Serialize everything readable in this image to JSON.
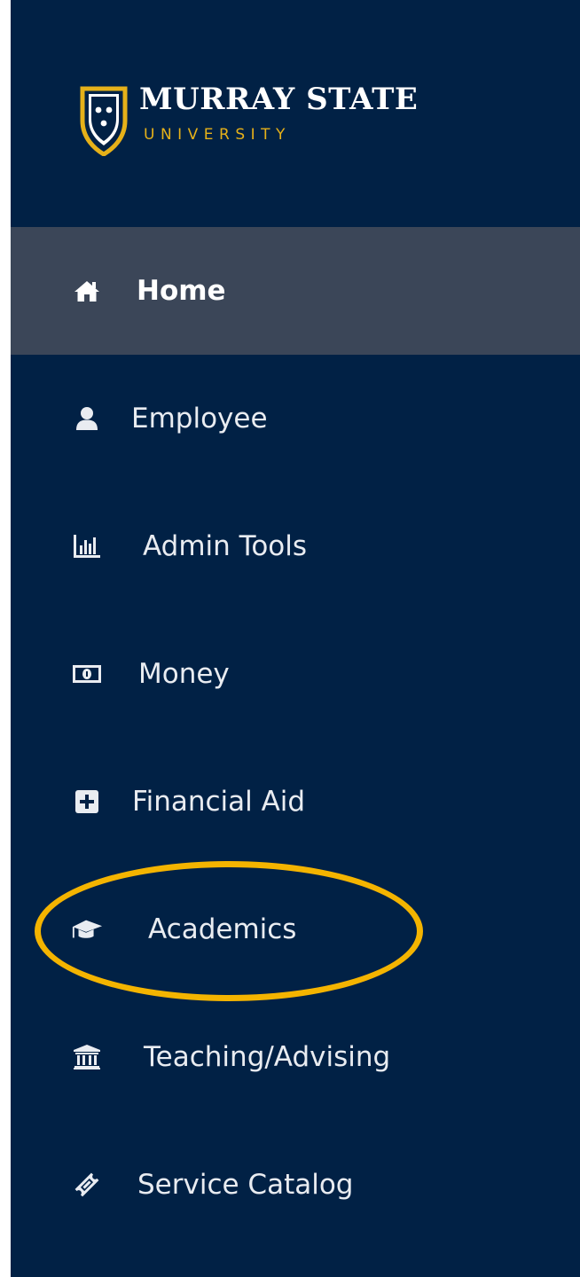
{
  "logo": {
    "name_top": "MURRAY STATE",
    "name_bottom": "UNIVERSITY",
    "shield_icon": "university-shield-icon",
    "accent_color": "#e6b119"
  },
  "theme": {
    "sidebar_bg": "#012145",
    "active_bg": "#3b4658",
    "highlight_color": "#f4b400"
  },
  "nav": {
    "items": [
      {
        "label": "Home",
        "icon": "home-icon",
        "active": true
      },
      {
        "label": "Employee",
        "icon": "user-icon",
        "active": false
      },
      {
        "label": "Admin Tools",
        "icon": "bar-chart-icon",
        "active": false
      },
      {
        "label": "Money",
        "icon": "money-bill-icon",
        "active": false
      },
      {
        "label": "Financial Aid",
        "icon": "plus-square-icon",
        "active": false
      },
      {
        "label": "Academics",
        "icon": "graduation-cap-icon",
        "active": false,
        "highlighted": true
      },
      {
        "label": "Teaching/Advising",
        "icon": "institution-icon",
        "active": false
      },
      {
        "label": "Service Catalog",
        "icon": "ticket-icon",
        "active": false
      }
    ]
  }
}
